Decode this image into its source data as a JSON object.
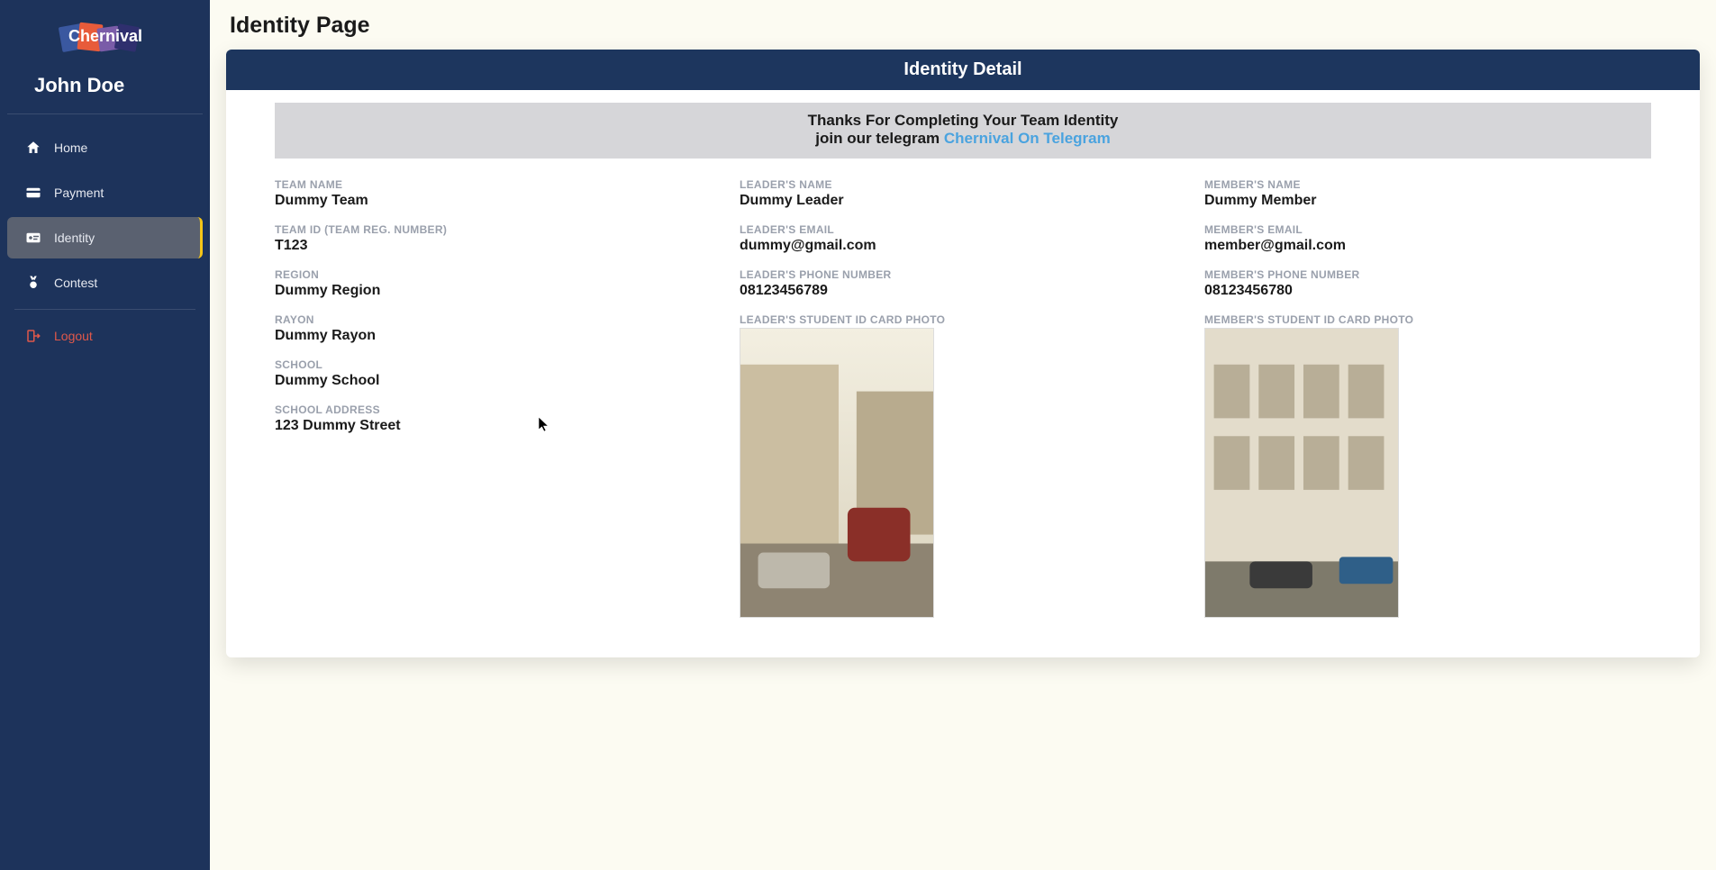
{
  "brand": "Chernival",
  "username": "John Doe",
  "nav": {
    "home": "Home",
    "payment": "Payment",
    "identity": "Identity",
    "contest": "Contest",
    "logout": "Logout"
  },
  "page_title": "Identity Page",
  "card_header": "Identity Detail",
  "banner": {
    "line1": "Thanks For Completing Your Team Identity",
    "line2_prefix": "join our telegram ",
    "link_text": "Chernival On Telegram"
  },
  "team": {
    "name_label": "TEAM NAME",
    "name_value": "Dummy Team",
    "id_label": "TEAM ID (TEAM REG. NUMBER)",
    "id_value": "T123",
    "region_label": "REGION",
    "region_value": "Dummy Region",
    "rayon_label": "RAYON",
    "rayon_value": "Dummy Rayon",
    "school_label": "SCHOOL",
    "school_value": "Dummy School",
    "address_label": "SCHOOL ADDRESS",
    "address_value": "123 Dummy Street"
  },
  "leader": {
    "name_label": "LEADER'S NAME",
    "name_value": "Dummy Leader",
    "email_label": "LEADER'S EMAIL",
    "email_value": "dummy@gmail.com",
    "phone_label": "LEADER'S PHONE NUMBER",
    "phone_value": "08123456789",
    "photo_label": "LEADER'S STUDENT ID CARD PHOTO"
  },
  "member": {
    "name_label": "MEMBER'S NAME",
    "name_value": "Dummy Member",
    "email_label": "MEMBER'S EMAIL",
    "email_value": "member@gmail.com",
    "phone_label": "MEMBER'S PHONE NUMBER",
    "phone_value": "08123456780",
    "photo_label": "MEMBER'S STUDENT ID CARD PHOTO"
  }
}
